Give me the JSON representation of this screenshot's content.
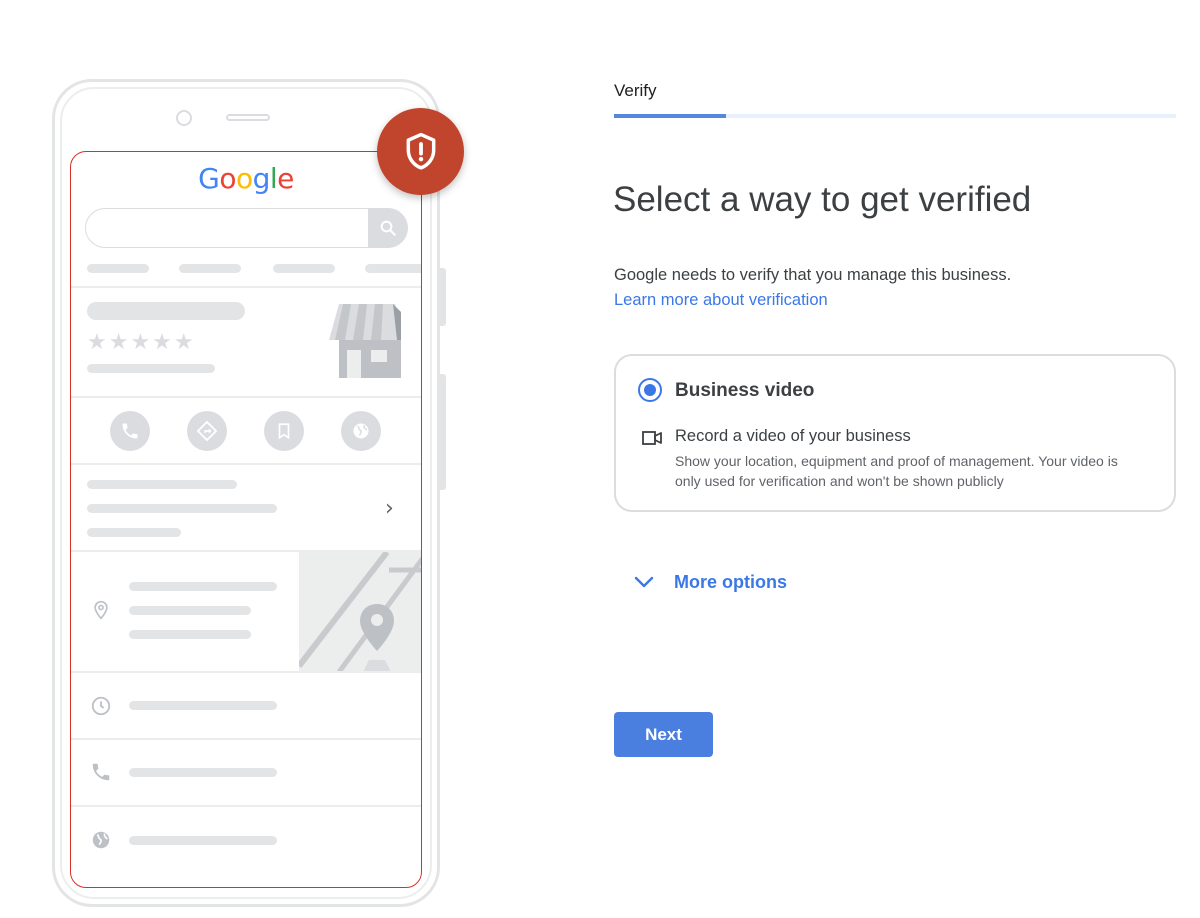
{
  "illustration": {
    "logo_text": "Google",
    "logo_colors": [
      "#4285f4",
      "#ea4335",
      "#fbbc05",
      "#4285f4",
      "#34a853",
      "#ea4335"
    ],
    "stars": "★★★★★",
    "badge_icon": "shield-alert-icon",
    "badge_color": "#c0452c",
    "screen_border_color": "#d93025",
    "action_icons": [
      "phone-icon",
      "directions-icon",
      "bookmark-icon",
      "globe-icon"
    ],
    "row_icons": [
      "location-pin-icon",
      "clock-icon",
      "phone-icon",
      "globe-icon"
    ]
  },
  "stepper": {
    "label": "Verify",
    "progress_fraction": 0.2
  },
  "page": {
    "title": "Select a way to get verified",
    "description": "Google needs to verify that you manage this business.",
    "learn_more_link": "Learn more about verification"
  },
  "option": {
    "selected": true,
    "title": "Business video",
    "subtitle_icon": "video-camera-icon",
    "subtitle": "Record a video of your business",
    "detail": "Show your location, equipment and proof of management. Your video is only used for verification and won't be shown publicly"
  },
  "more_options": {
    "label": "More options",
    "icon": "chevron-down-icon"
  },
  "actions": {
    "next_label": "Next"
  },
  "colors": {
    "accent": "#3b78e7",
    "button": "#4a7fe0"
  }
}
